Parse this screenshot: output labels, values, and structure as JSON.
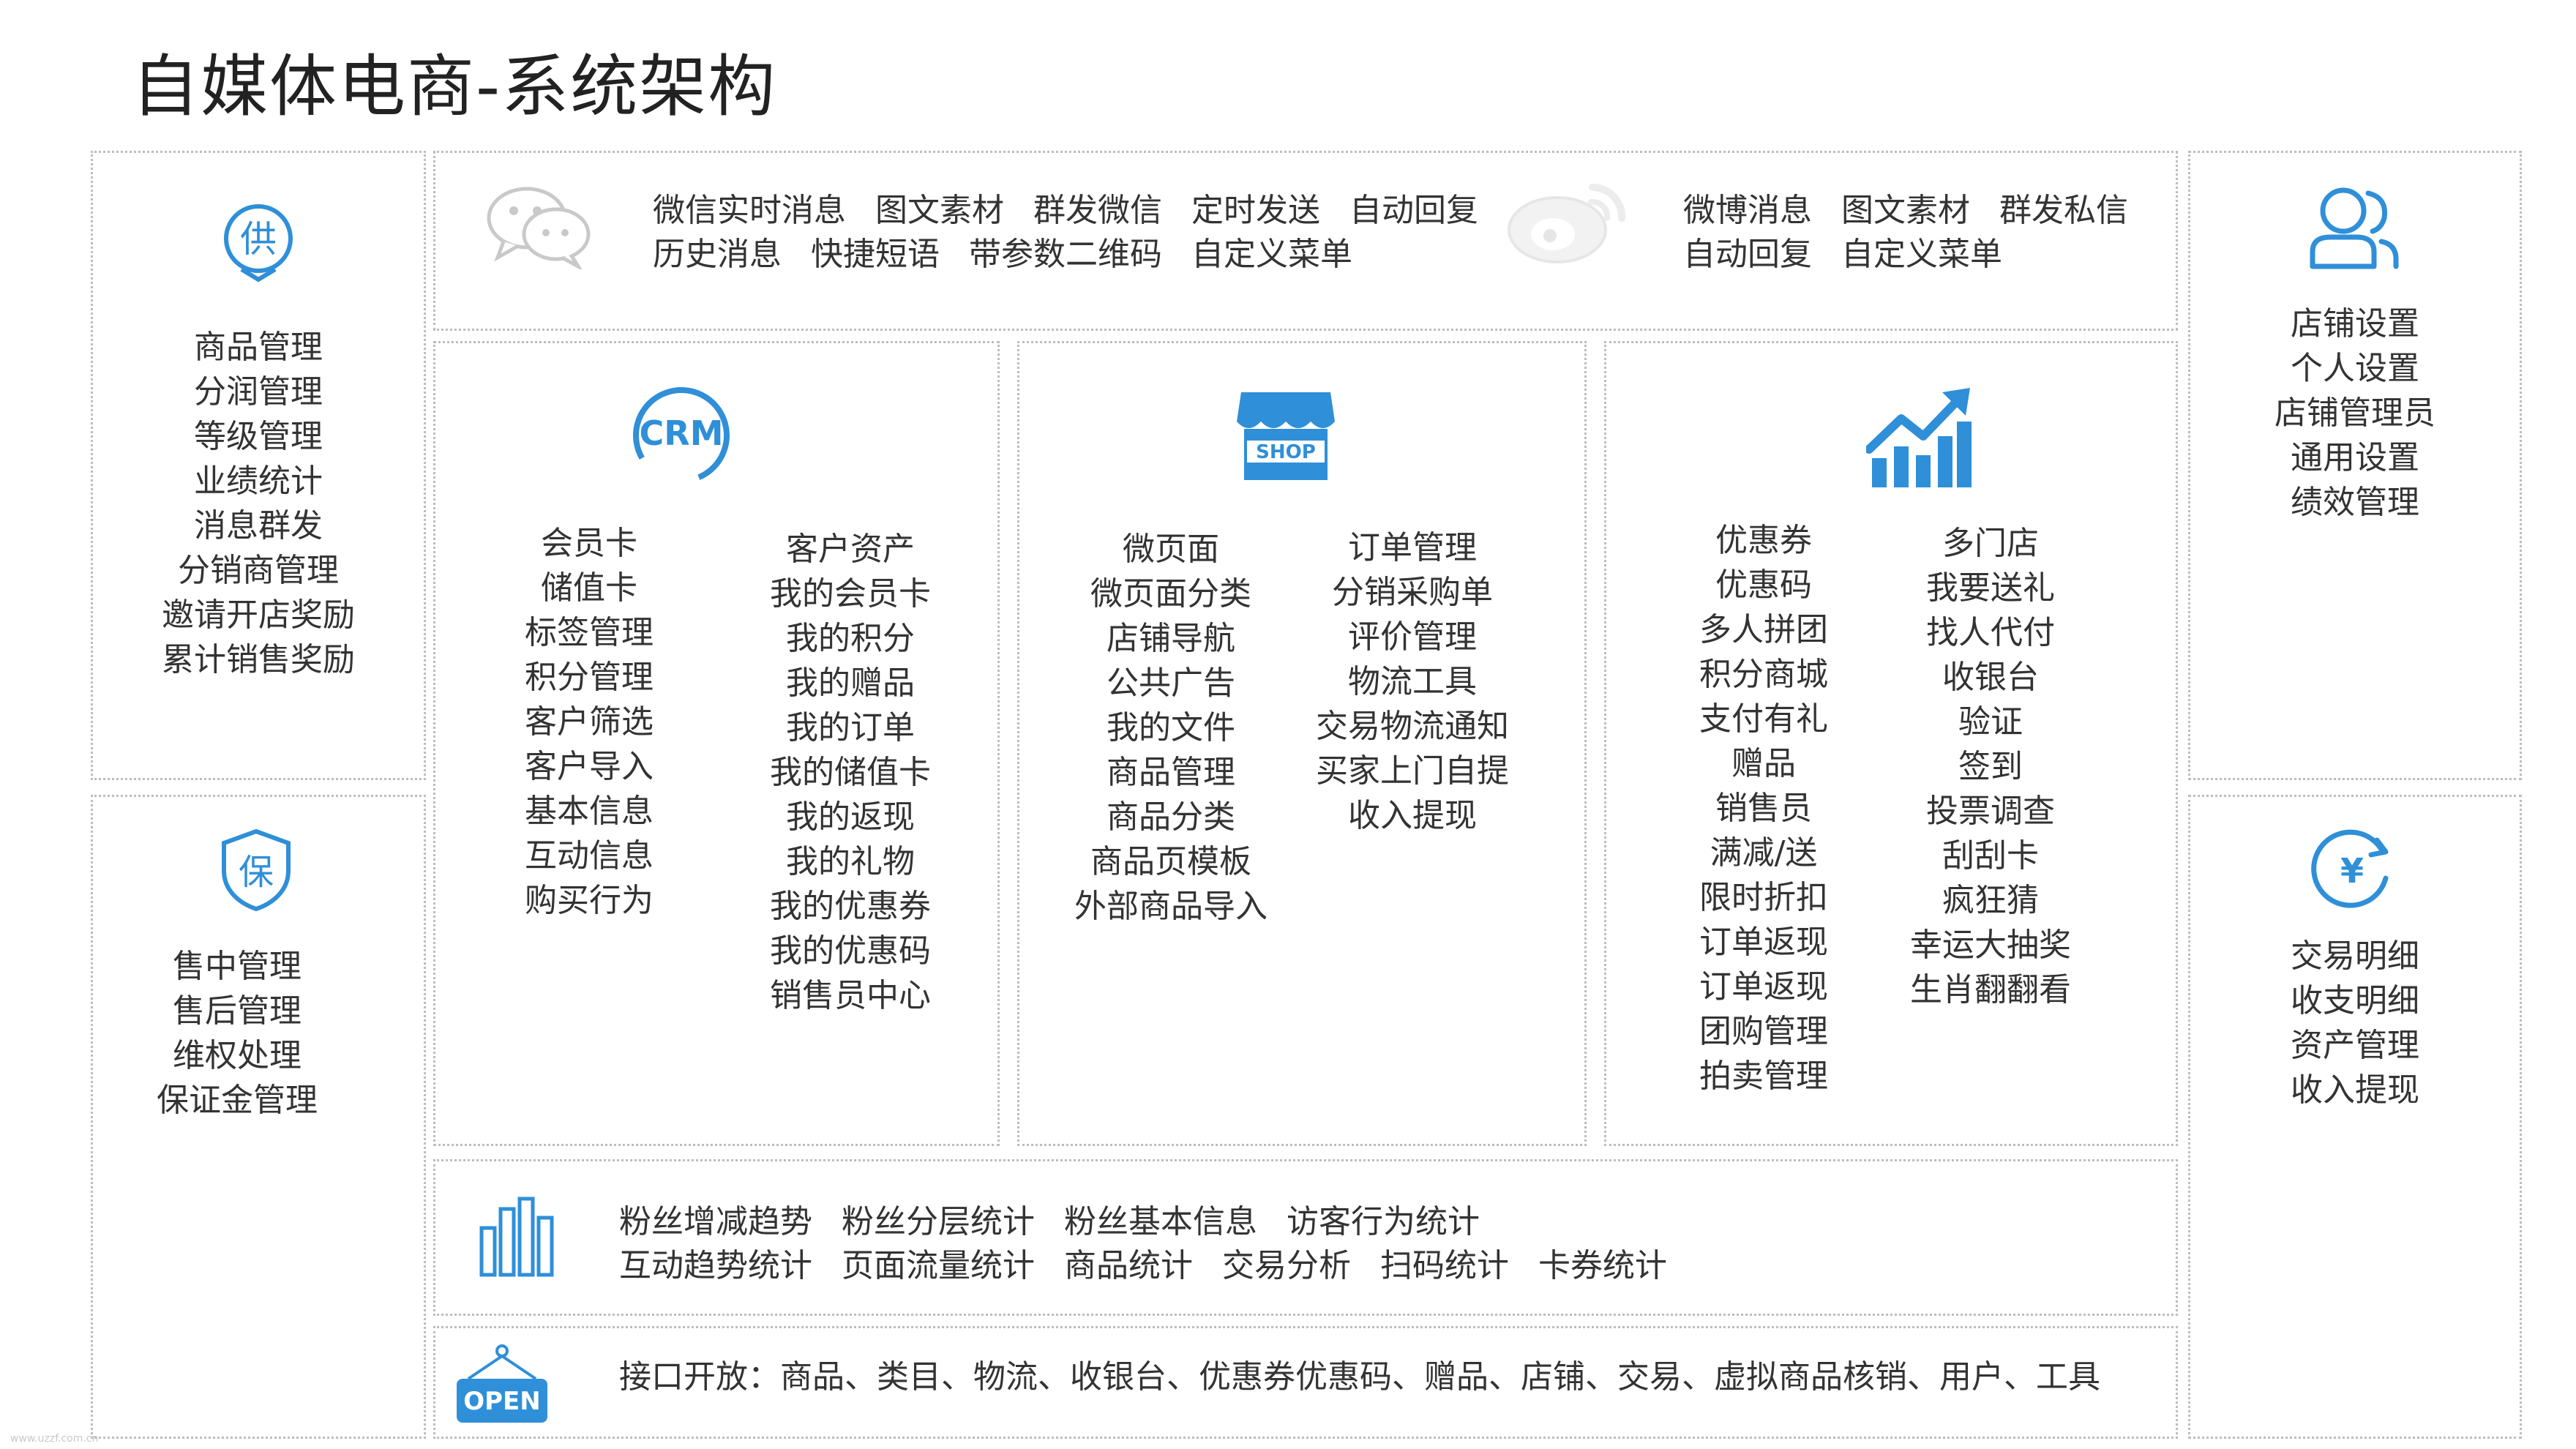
{
  "title": "自媒体电商-系统架构",
  "colors": {
    "accent": "#2f8fd8",
    "border": "#bdbdbd",
    "text": "#333333"
  },
  "wechat": {
    "icon": "wechat-icon",
    "row1": [
      "微信实时消息",
      "图文素材",
      "群发微信",
      "定时发送",
      "自动回复"
    ],
    "row2": [
      "历史消息",
      "快捷短语",
      "带参数二维码",
      "自定义菜单"
    ]
  },
  "weibo": {
    "icon": "weibo-icon",
    "row1": [
      "微博消息",
      "图文素材",
      "群发私信"
    ],
    "row2": [
      "自动回复",
      "自定义菜单"
    ]
  },
  "supply": {
    "icon_text": "供",
    "items": [
      "商品管理",
      "分润管理",
      "等级管理",
      "业绩统计",
      "消息群发",
      "分销商管理",
      "邀请开店奖励",
      "累计销售奖励"
    ]
  },
  "guarantee": {
    "icon_text": "保",
    "items": [
      "售中管理",
      "售后管理",
      "维权处理",
      "保证金管理"
    ]
  },
  "crm": {
    "icon_text": "CRM",
    "col1": [
      "会员卡",
      "储值卡",
      "标签管理",
      "积分管理",
      "客户筛选",
      "客户导入",
      "基本信息",
      "互动信息",
      "购买行为"
    ],
    "col2": [
      "客户资产",
      "我的会员卡",
      "我的积分",
      "我的赠品",
      "我的订单",
      "我的储值卡",
      "我的返现",
      "我的礼物",
      "我的优惠券",
      "我的优惠码",
      "销售员中心"
    ]
  },
  "shop": {
    "icon_text": "SHOP",
    "col1": [
      "微页面",
      "微页面分类",
      "店铺导航",
      "公共广告",
      "我的文件",
      "商品管理",
      "商品分类",
      "商品页模板",
      "外部商品导入"
    ],
    "col2": [
      "订单管理",
      "分销采购单",
      "评价管理",
      "物流工具",
      "交易物流通知",
      "买家上门自提",
      "收入提现"
    ]
  },
  "marketing": {
    "icon": "growth-chart-icon",
    "col1": [
      "优惠券",
      "优惠码",
      "多人拼团",
      "积分商城",
      "支付有礼",
      "赠品",
      "销售员",
      "满减/送",
      "限时折扣",
      "订单返现",
      "订单返现",
      "团购管理",
      "拍卖管理"
    ],
    "col2": [
      "多门店",
      "我要送礼",
      "找人代付",
      "收银台",
      "验证",
      "签到",
      "投票调查",
      "刮刮卡",
      "疯狂猜",
      "幸运大抽奖",
      "生肖翻翻看"
    ]
  },
  "settings": {
    "icon": "users-icon",
    "items": [
      "店铺设置",
      "个人设置",
      "店铺管理员",
      "通用设置",
      "绩效管理"
    ]
  },
  "finance": {
    "icon_text": "¥",
    "items": [
      "交易明细",
      "收支明细",
      "资产管理",
      "收入提现"
    ]
  },
  "stats": {
    "icon": "bar-chart-icon",
    "row1": [
      "粉丝增减趋势",
      "粉丝分层统计",
      "粉丝基本信息",
      "访客行为统计"
    ],
    "row2": [
      "互动趋势统计",
      "页面流量统计",
      "商品统计",
      "交易分析",
      "扫码统计",
      "卡券统计"
    ]
  },
  "api": {
    "icon_text": "OPEN",
    "text": "接口开放：商品、类目、物流、收银台、优惠券优惠码、赠品、店铺、交易、虚拟商品核销、用户、工具"
  },
  "watermark": "www.uzzf.com.cn"
}
